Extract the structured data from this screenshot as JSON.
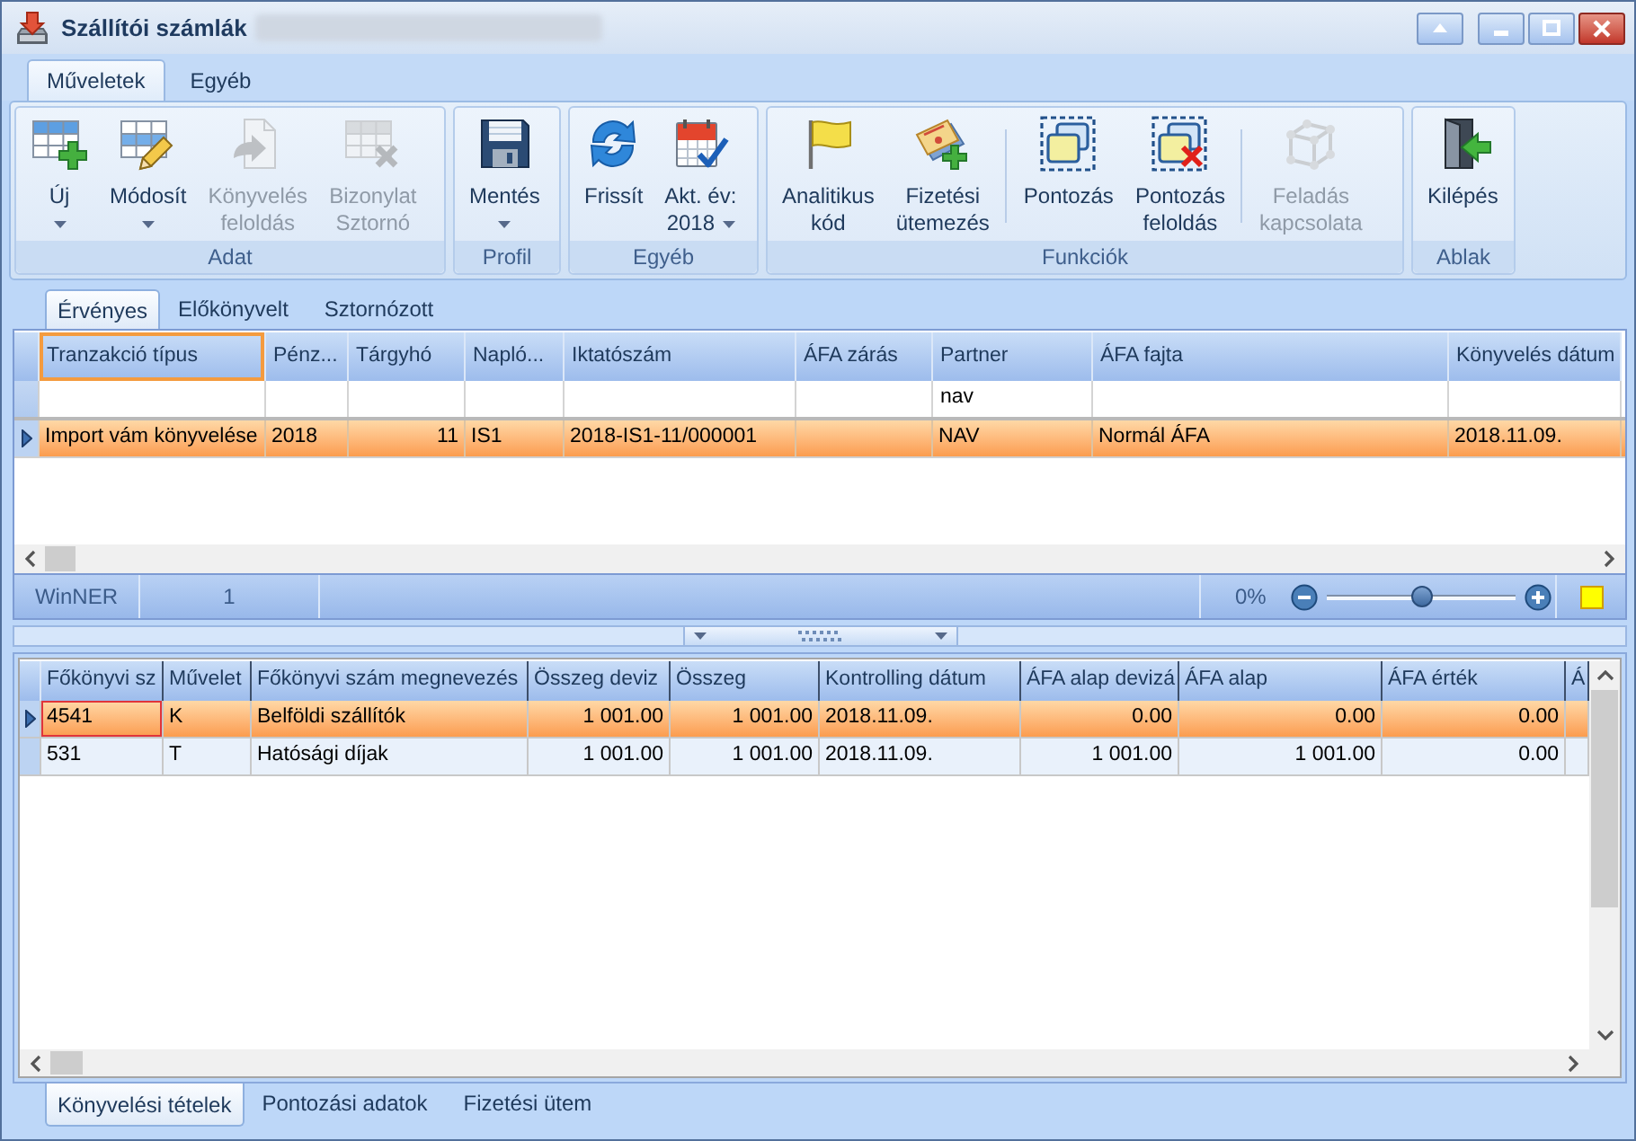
{
  "window": {
    "title": "Szállítói számlák"
  },
  "ribbon": {
    "tabs": [
      {
        "label": "Műveletek",
        "selected": true
      },
      {
        "label": "Egyéb",
        "selected": false
      }
    ],
    "groups": [
      {
        "label": "Adat",
        "buttons": [
          {
            "label": "Új",
            "dropdown": true,
            "disabled": false
          },
          {
            "label": "Módosít",
            "dropdown": true,
            "disabled": false
          },
          {
            "label": "Könyvelés\nfeloldás",
            "dropdown": false,
            "disabled": true
          },
          {
            "label": "Bizonylat\nSztornó",
            "dropdown": false,
            "disabled": true
          }
        ]
      },
      {
        "label": "Profil",
        "buttons": [
          {
            "label": "Mentés",
            "dropdown": true,
            "disabled": false
          }
        ]
      },
      {
        "label": "Egyéb",
        "buttons": [
          {
            "label": "Frissít",
            "dropdown": false,
            "disabled": false
          },
          {
            "label": "Akt. év:\n2018",
            "dropdown": true,
            "disabled": false
          }
        ]
      },
      {
        "label": "Funkciók",
        "buttons": [
          {
            "label": "Analitikus\nkód",
            "dropdown": false,
            "disabled": false
          },
          {
            "label": "Fizetési\nütemezés",
            "dropdown": false,
            "disabled": false
          },
          {
            "label": "Pontozás",
            "dropdown": false,
            "disabled": false
          },
          {
            "label": "Pontozás\nfeloldás",
            "dropdown": false,
            "disabled": false
          },
          {
            "label": "Feladás\nkapcsolata",
            "dropdown": false,
            "disabled": true
          }
        ]
      },
      {
        "label": "Ablak",
        "buttons": [
          {
            "label": "Kilépés",
            "dropdown": false,
            "disabled": false
          }
        ]
      }
    ]
  },
  "record_tabs": [
    {
      "label": "Érvényes",
      "selected": true
    },
    {
      "label": "Előkönyvelt",
      "selected": false
    },
    {
      "label": "Sztornózott",
      "selected": false
    }
  ],
  "transactions_table": {
    "columns": [
      {
        "label": "Tranzakció típus",
        "selected": true
      },
      {
        "label": "Pénz...",
        "selected": false
      },
      {
        "label": "Tárgyhó",
        "selected": false
      },
      {
        "label": "Napló...",
        "selected": false
      },
      {
        "label": "Iktatószám",
        "selected": false
      },
      {
        "label": "ÁFA zárás",
        "selected": false
      },
      {
        "label": "Partner",
        "selected": false,
        "filter": "nav"
      },
      {
        "label": "ÁFA fajta",
        "selected": false
      },
      {
        "label": "Könyvelés dátum",
        "selected": false
      }
    ],
    "rows": [
      {
        "selected": true,
        "cells": [
          "Import vám könyvelése",
          "2018",
          "11",
          "IS1",
          "2018-IS1-11/000001",
          null,
          "NAV",
          "Normál ÁFA",
          "2018.11.09."
        ]
      }
    ]
  },
  "status_bar": {
    "source": "WinNER",
    "count": "1",
    "zoom_reading": "0%",
    "zoom": {
      "level": 0.5
    }
  },
  "entries_table": {
    "columns": [
      "Főkönyvi sz",
      "Művelet",
      "Főkönyvi szám megnevezés",
      "Összeg deviz",
      "Összeg",
      "Kontrolling dátum",
      "ÁFA alap devizá",
      "ÁFA alap",
      "ÁFA érték",
      "Á"
    ],
    "rows": [
      {
        "selected": true,
        "focused": true,
        "cells": [
          "4541",
          "K",
          "Belföldi szállítók",
          "1 001.00",
          "1 001.00",
          "2018.11.09.",
          "0.00",
          "0.00",
          "0.00"
        ]
      },
      {
        "selected": false,
        "focused": false,
        "cells": [
          "531",
          "T",
          "Hatósági díjak",
          "1 001.00",
          "1 001.00",
          "2018.11.09.",
          "1 001.00",
          "1 001.00",
          "0.00"
        ]
      }
    ]
  },
  "detail_tabs": [
    {
      "label": "Könyvelési tételek",
      "selected": true
    },
    {
      "label": "Pontozási adatok",
      "selected": false
    },
    {
      "label": "Fizetési ütem",
      "selected": false
    }
  ]
}
